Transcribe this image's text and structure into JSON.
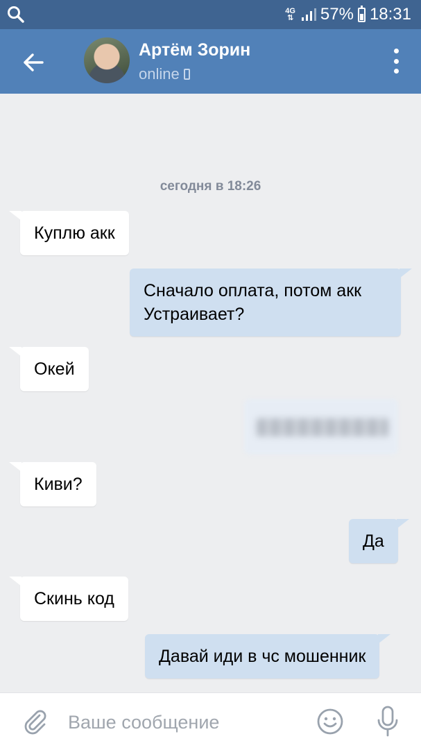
{
  "status_bar": {
    "network": "4G",
    "battery": "57%",
    "time": "18:31"
  },
  "header": {
    "contact_name": "Артём Зорин",
    "contact_status": "online"
  },
  "chat": {
    "date_separator": "сегодня в 18:26",
    "messages": [
      {
        "direction": "in",
        "text": "Куплю акк"
      },
      {
        "direction": "out",
        "lines": [
          "Сначало оплата, потом акк",
          "Устраивает?"
        ]
      },
      {
        "direction": "in",
        "text": "Окей"
      },
      {
        "direction": "out",
        "text": "",
        "blurred": true
      },
      {
        "direction": "in",
        "text": "Киви?"
      },
      {
        "direction": "out",
        "text": "Да"
      },
      {
        "direction": "in",
        "text": "Скинь код"
      },
      {
        "direction": "out",
        "text": "Давай иди в чс мошенник"
      }
    ]
  },
  "composer": {
    "placeholder": "Ваше сообщение"
  },
  "colors": {
    "status_bar": "#3f6491",
    "header": "#5181b8",
    "chat_bg": "#edeef0",
    "incoming_bubble": "#ffffff",
    "outgoing_bubble": "#cfdff0"
  }
}
